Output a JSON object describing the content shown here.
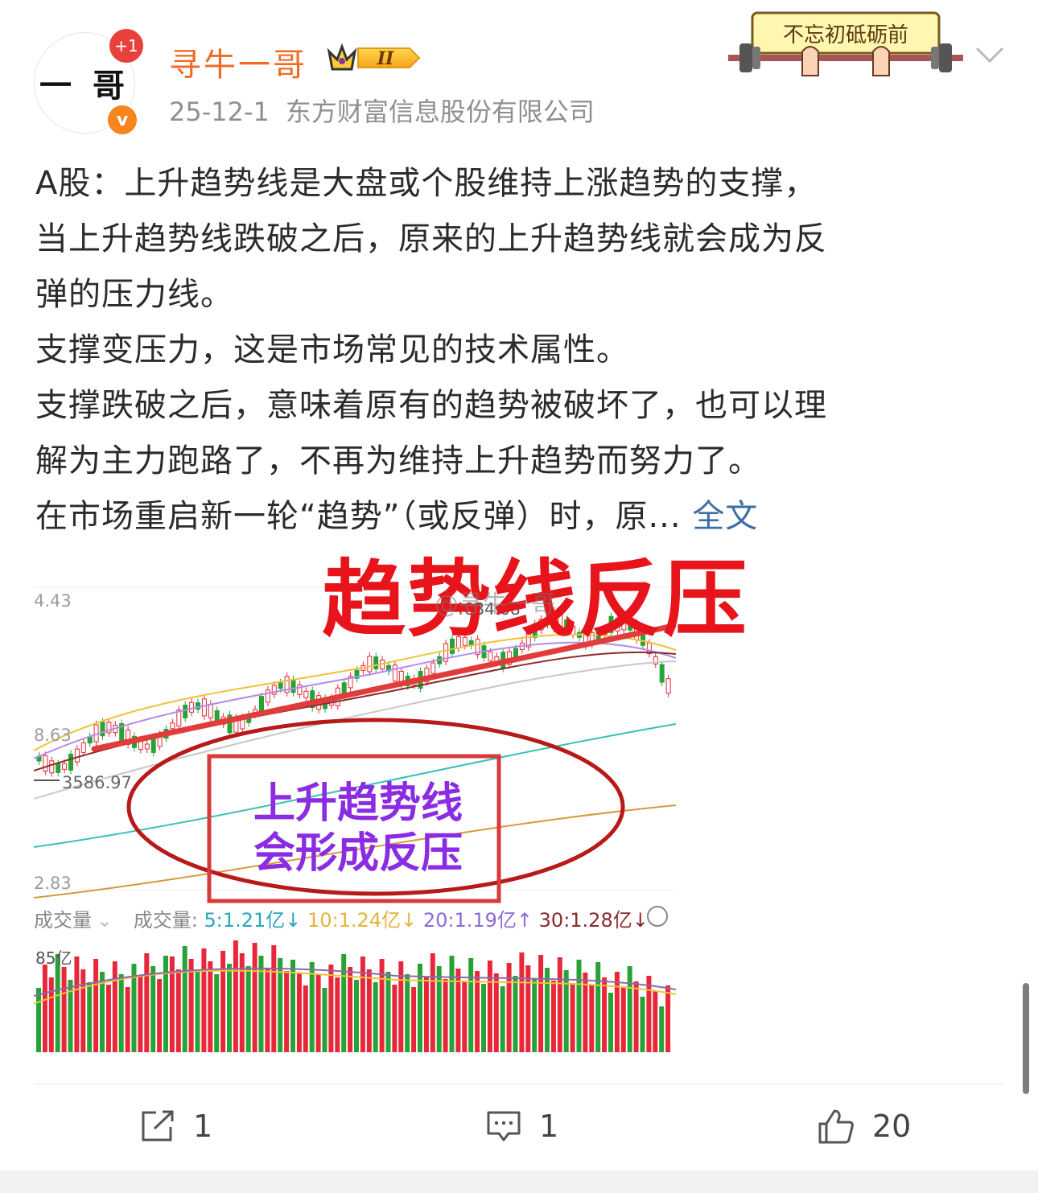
{
  "user": {
    "avatar_text": "一 哥",
    "plus_badge": "+1",
    "verified_mark": "v",
    "name": "寻牛一哥",
    "level_badge": "II",
    "date": "25-12-1",
    "source": "东方财富信息股份有限公司"
  },
  "decoration": {
    "banner_text": "不忘初砥砺前"
  },
  "post": {
    "lines": [
      "A股：上升趋势线是大盘或个股维持上涨趋势的支撑，",
      "当上升趋势线跌破之后，原来的上升趋势线就会成为反",
      "弹的压力线。",
      "支撑变压力，这是市场常见的技术属性。",
      "支撑跌破之后，意味着原有的趋势被破坏了，也可以理",
      "解为主力跑路了，不再为维持上升趋势而努力了。",
      "在市场重启新一轮“趋势”（或反弹）时，原..."
    ],
    "full_link": "全文"
  },
  "image": {
    "headline": "趋势线反压",
    "watermark": "@寻牛一哥",
    "price_labels": [
      "4.43",
      "8.63",
      "2.83"
    ],
    "peak_label": "4034.08",
    "level_label": "3586.97",
    "box_lines": [
      "上升趋势线",
      "会形成反压"
    ],
    "volume_dropdown": "成交量",
    "volume_title": "成交量:",
    "ma5": "5:1.21亿↓",
    "ma10": "10:1.24亿↓",
    "ma20": "20:1.19亿↑",
    "ma30": "30:1.28亿↓",
    "volume_scale": "85亿"
  },
  "actions": {
    "share_count": "1",
    "comment_count": "1",
    "like_count": "20"
  },
  "icons": [
    "share-icon",
    "comment-icon",
    "like-icon",
    "settings-icon",
    "chevron-down-icon",
    "crown-icon"
  ],
  "colors": {
    "username": "#f06a25",
    "link": "#3e6ea8",
    "headline": "#e8141c",
    "candle_up": "#e8283a",
    "candle_down": "#27a336",
    "box_text": "#8b2be2"
  }
}
